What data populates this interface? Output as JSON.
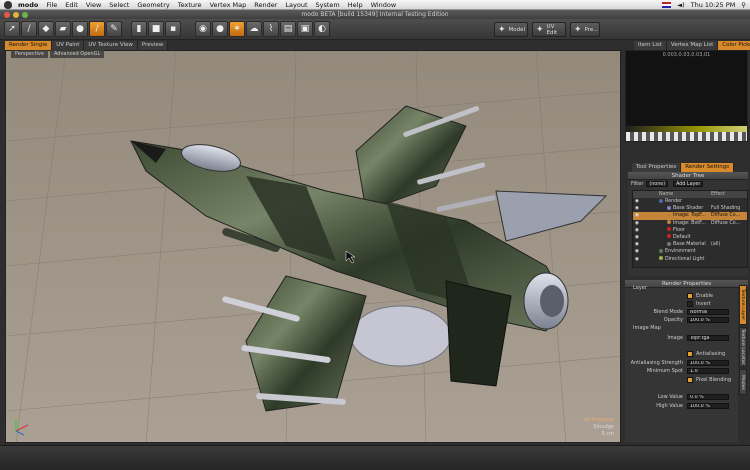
{
  "menubar": {
    "app": "modo",
    "items": [
      "File",
      "Edit",
      "View",
      "Select",
      "Geometry",
      "Texture",
      "Vertex Map",
      "Render",
      "Layout",
      "System",
      "Help",
      "Window"
    ],
    "clock": "Thu 10:25 PM"
  },
  "window": {
    "title": "modo BETA [build 15349] Internal Testing Edition"
  },
  "toolbar": {
    "model": "Model",
    "uv_edit": "UV Edit",
    "pre": "Pre..."
  },
  "left_tabs": [
    "Render Single",
    "UV Paint",
    "UV Texture View",
    "Preview"
  ],
  "right_tabs": [
    "Item List",
    "Vertex Map List",
    "Color Picker"
  ],
  "viewport": {
    "tabs": [
      "Perspective",
      "Advanced OpenGL"
    ],
    "info": {
      "polys": "All Polygons",
      "mode": "Smudge",
      "scale": "5 cm"
    }
  },
  "preview": {
    "readout": "0.003,0.03,0.03,01"
  },
  "mid_tabs": [
    "Tool Properties",
    "Render Settings"
  ],
  "shader_tree": {
    "title": "Shader Tree",
    "filter_label": "Filter",
    "filter_value": "(none)",
    "add_layer": "Add Layer",
    "col_name": "Name",
    "col_effect": "Effect",
    "rows": [
      {
        "name": "Render",
        "effect": "",
        "indent": 0,
        "color": "#4a6fa5"
      },
      {
        "name": "Base Shader",
        "effect": "Full Shading",
        "indent": 1,
        "color": "#8080c0"
      },
      {
        "name": "Image: TopF...",
        "effect": "Diffuse Co...",
        "indent": 1,
        "color": "#c08040",
        "selected": true
      },
      {
        "name": "Image: BotF...",
        "effect": "Diffuse Co...",
        "indent": 1,
        "color": "#c08040"
      },
      {
        "name": "Floor",
        "effect": "",
        "indent": 1,
        "color": "#cc2222"
      },
      {
        "name": "Default",
        "effect": "",
        "indent": 1,
        "color": "#cc2222"
      },
      {
        "name": "Base Material",
        "effect": "(all)",
        "indent": 1,
        "color": "#777777"
      },
      {
        "name": "Environment",
        "effect": "",
        "indent": 0,
        "color": "#5a7f5a"
      },
      {
        "name": "Directional Light",
        "effect": "",
        "indent": 0,
        "color": "#aaaa55"
      }
    ]
  },
  "render_props": {
    "title": "Render Properties",
    "layer_label": "Layer",
    "enable": "Enable",
    "invert": "Invert",
    "blend_mode_label": "Blend Mode",
    "blend_mode": "Normal",
    "opacity_label": "Opacity",
    "opacity": "100.0 %",
    "image_map_label": "Image Map",
    "image_label": "Image",
    "image": "TopF.tga",
    "antialiasing": "Antialiasing",
    "aa_strength_label": "Antialiasing Strength",
    "aa_strength": "100.0 %",
    "min_spot_label": "Minimum Spot",
    "min_spot": "1.0",
    "pixel_blending": "Pixel Blending",
    "low_label": "Low Value",
    "low": "0.0 %",
    "high_label": "High Value",
    "high": "100.0 %"
  },
  "side_tabs": [
    "Texture Layer",
    "Texture Locator",
    "Modes"
  ]
}
